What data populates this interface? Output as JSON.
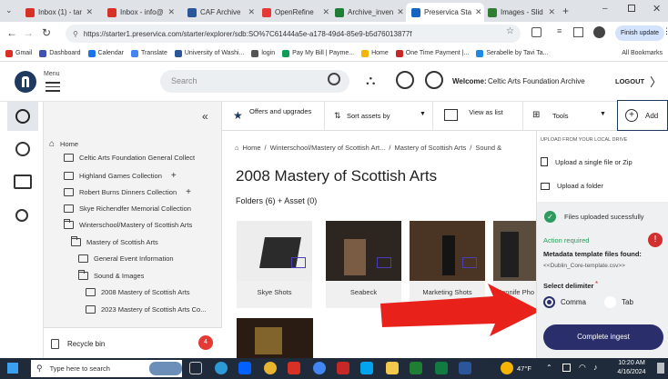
{
  "browser": {
    "tabs": [
      {
        "label": "Inbox (1) - tar",
        "color": "#d93025"
      },
      {
        "label": "Inbox - info@",
        "color": "#d93025"
      },
      {
        "label": "CAF Archive",
        "color": "#2b579a"
      },
      {
        "label": "OpenRefine",
        "color": "#e53935"
      },
      {
        "label": "Archive_inven",
        "color": "#1e7e34"
      },
      {
        "label": "Preservica Sta",
        "color": "#1565c0"
      },
      {
        "label": "Images - Slid",
        "color": "#2e7d32"
      }
    ],
    "url": "https://starter1.preservica.com/starter/explorer/sdb:SO%7C61444a5e-a178-49d4-85e9-b5d76013877f",
    "update_label": "Finish update",
    "bookmarks": [
      "Gmail",
      "Dashboard",
      "Calendar",
      "Translate",
      "University of Washi...",
      "login",
      "Pay My Bill | Payme...",
      "Home",
      "One Time Payment |...",
      "Serabelle by Tavi Ta..."
    ],
    "all_bookmarks": "All Bookmarks"
  },
  "app": {
    "menu_label": "Menu",
    "search_placeholder": "Search",
    "welcome_label": "Welcome:",
    "welcome_user": "Celtic Arts Foundation Archive",
    "logout": "LOGOUT"
  },
  "tree": {
    "home": "Home",
    "items": [
      {
        "label": "Celtic Arts Foundation General Collect",
        "level": 1,
        "plus": false,
        "open": false
      },
      {
        "label": "Highland Games Collection",
        "level": 1,
        "plus": true,
        "open": false
      },
      {
        "label": "Robert Burns Dinners Collection",
        "level": 1,
        "plus": true,
        "open": false
      },
      {
        "label": "Skye Richendfer Memorial Collection",
        "level": 1,
        "plus": false,
        "open": false
      },
      {
        "label": "Winterschool/Mastery of Scottish Arts",
        "level": 1,
        "plus": false,
        "open": true
      },
      {
        "label": "Mastery of Scottish Arts",
        "level": 2,
        "plus": false,
        "open": true
      },
      {
        "label": "General Event Information",
        "level": 3,
        "plus": false,
        "open": false
      },
      {
        "label": "Sound & Images",
        "level": 3,
        "plus": false,
        "open": true
      },
      {
        "label": "2008 Mastery of Scottish Arts",
        "level": 4,
        "plus": false,
        "open": false
      },
      {
        "label": "2023 Mastery of Scottish Arts Co...",
        "level": 4,
        "plus": false,
        "open": false
      }
    ],
    "recycle": "Recycle bin",
    "recycle_count": "4"
  },
  "toolbar": {
    "offers": "Offers and upgrades",
    "sort": "Sort assets by",
    "view": "View as list",
    "tools": "Tools",
    "add": "Add"
  },
  "main": {
    "breadcrumb": [
      "Home",
      "Winterschool/Mastery of Scottish Art...",
      "Mastery of Scottish Arts",
      "Sound &"
    ],
    "title": "2008 Mastery of Scottish Arts",
    "counts": "Folders (6) + Asset (0)",
    "tiles": [
      "Skye Shots",
      "Seabeck",
      "Marketing Shots",
      "Jennife Pho"
    ]
  },
  "upload": {
    "header": "UPLOAD FROM YOUR LOCAL DRIVE",
    "single": "Upload a single file or Zip",
    "folder": "Upload a folder",
    "success": "Files uploaded sucessfully",
    "action": "Action required",
    "template_label": "Metadata template files found:",
    "template_file": "<<Dublin_Core-template.csv>>",
    "delimiter_label": "Select delimiter",
    "required_mark": "*",
    "comma": "Comma",
    "tab": "Tab",
    "complete": "Complete ingest"
  },
  "taskbar": {
    "search": "Type here to search",
    "weather": "47°F",
    "time": "10:20 AM",
    "date": "4/16/2024"
  }
}
